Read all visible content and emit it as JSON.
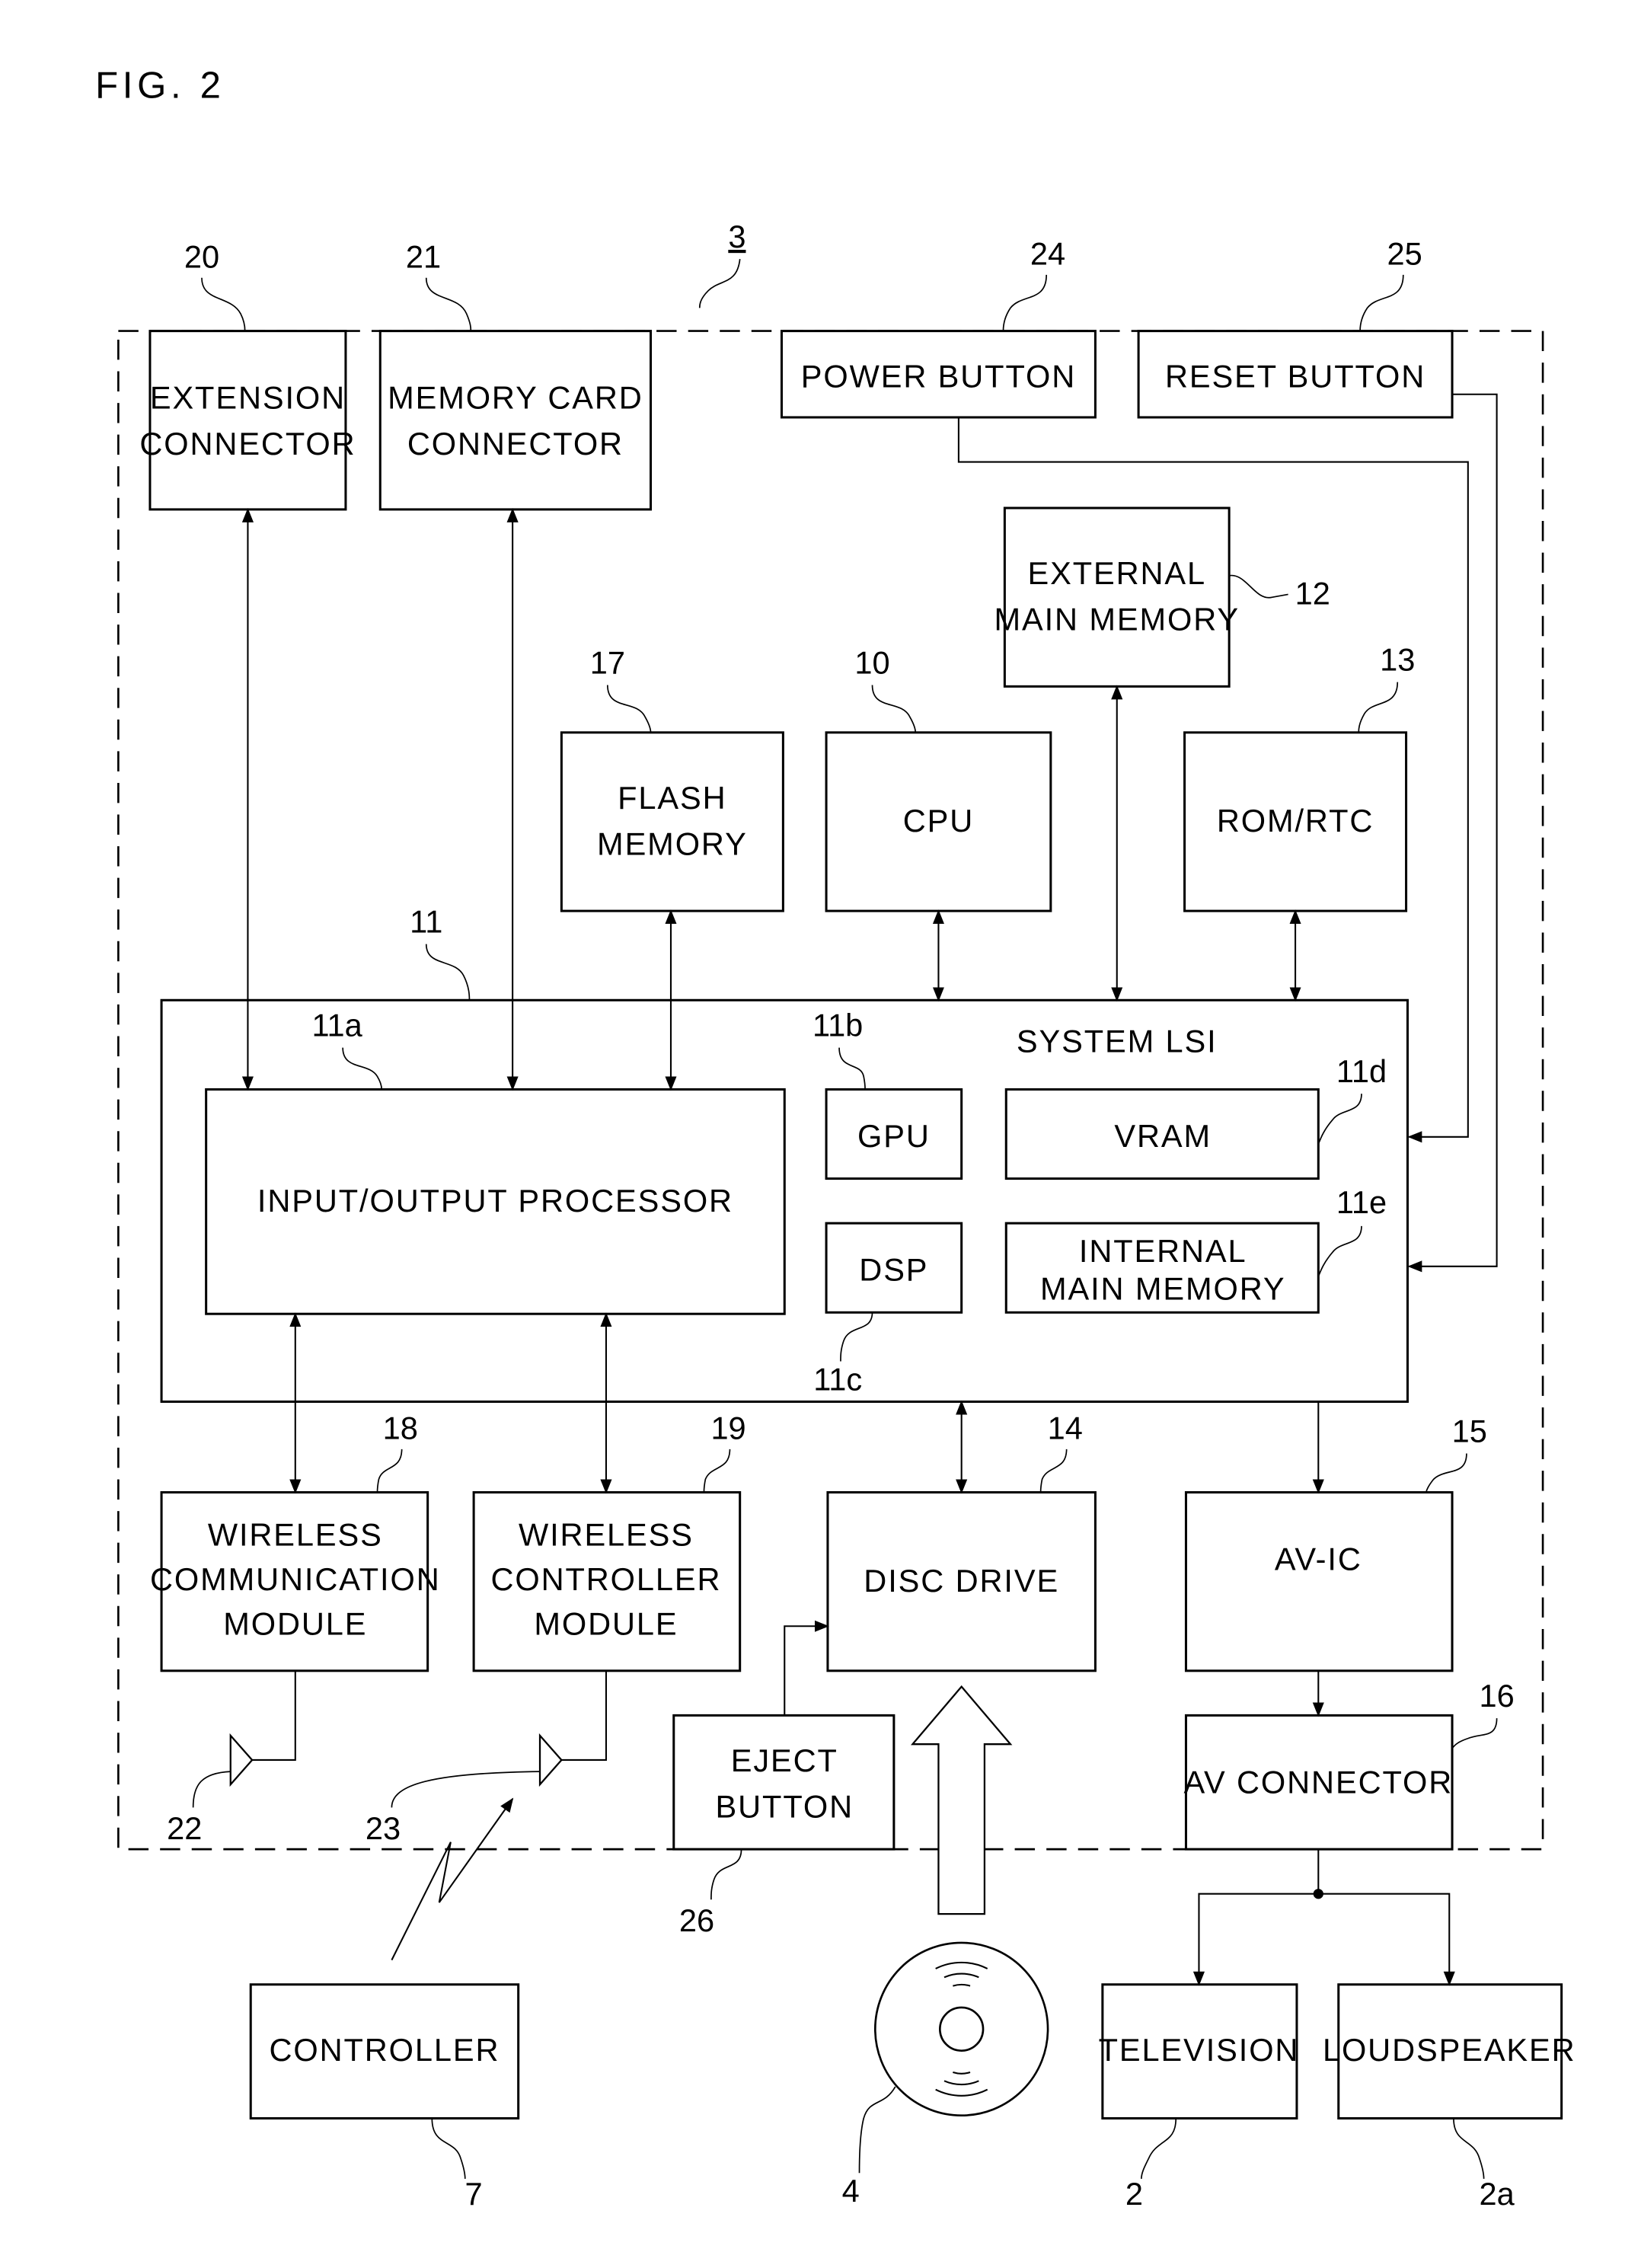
{
  "figure_label": "FIG. 2",
  "device_ref": "3",
  "blocks": {
    "extension_connector": {
      "lines": [
        "EXTENSION",
        "CONNECTOR"
      ],
      "ref": "20"
    },
    "memory_card_connector": {
      "lines": [
        "MEMORY CARD",
        "CONNECTOR"
      ],
      "ref": "21"
    },
    "power_button": {
      "lines": [
        "POWER BUTTON"
      ],
      "ref": "24"
    },
    "reset_button": {
      "lines": [
        "RESET BUTTON"
      ],
      "ref": "25"
    },
    "external_main_memory": {
      "lines": [
        "EXTERNAL",
        "MAIN MEMORY"
      ],
      "ref": "12"
    },
    "flash_memory": {
      "lines": [
        "FLASH",
        "MEMORY"
      ],
      "ref": "17"
    },
    "cpu": {
      "lines": [
        "CPU"
      ],
      "ref": "10"
    },
    "rom_rtc": {
      "lines": [
        "ROM/RTC"
      ],
      "ref": "13"
    },
    "system_lsi": {
      "lines": [
        "SYSTEM LSI"
      ],
      "ref": "11"
    },
    "io_processor": {
      "lines": [
        "INPUT/OUTPUT PROCESSOR"
      ],
      "ref": "11a"
    },
    "gpu": {
      "lines": [
        "GPU"
      ],
      "ref": "11b"
    },
    "dsp": {
      "lines": [
        "DSP"
      ],
      "ref": "11c"
    },
    "vram": {
      "lines": [
        "VRAM"
      ],
      "ref": "11d"
    },
    "internal_main_memory": {
      "lines": [
        "INTERNAL",
        "MAIN MEMORY"
      ],
      "ref": "11e"
    },
    "wireless_communication_module": {
      "lines": [
        "WIRELESS",
        "COMMUNICATION",
        "MODULE"
      ],
      "ref": "18"
    },
    "wireless_controller_module": {
      "lines": [
        "WIRELESS",
        "CONTROLLER",
        "MODULE"
      ],
      "ref": "19"
    },
    "disc_drive": {
      "lines": [
        "DISC DRIVE"
      ],
      "ref": "14"
    },
    "av_ic": {
      "lines": [
        "AV-IC"
      ],
      "ref": "15"
    },
    "av_connector": {
      "lines": [
        "AV CONNECTOR"
      ],
      "ref": "16"
    },
    "eject_button": {
      "lines": [
        "EJECT",
        "BUTTON"
      ],
      "ref": "26"
    },
    "controller": {
      "lines": [
        "CONTROLLER"
      ],
      "ref": "7"
    },
    "television": {
      "lines": [
        "TELEVISION"
      ],
      "ref": "2"
    },
    "loudspeaker": {
      "lines": [
        "LOUDSPEAKER"
      ],
      "ref": "2a"
    }
  },
  "antennas": {
    "wireless_comm_antenna_ref": "22",
    "wireless_ctrl_antenna_ref": "23"
  },
  "optical_disc_ref": "4"
}
